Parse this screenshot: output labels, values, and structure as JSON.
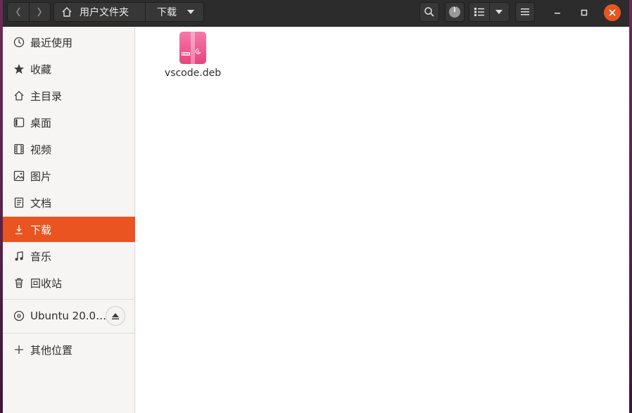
{
  "header": {
    "path": [
      {
        "label": "用户文件夹",
        "icon": "home-icon"
      },
      {
        "label": "下载",
        "icon": "chevron-down-icon"
      }
    ]
  },
  "sidebar": {
    "items": [
      {
        "label": "最近使用",
        "icon": "clock-icon"
      },
      {
        "label": "收藏",
        "icon": "star-icon"
      },
      {
        "label": "主目录",
        "icon": "home-icon"
      },
      {
        "label": "桌面",
        "icon": "desktop-icon"
      },
      {
        "label": "视频",
        "icon": "film-icon"
      },
      {
        "label": "图片",
        "icon": "image-icon"
      },
      {
        "label": "文档",
        "icon": "document-icon"
      },
      {
        "label": "下载",
        "icon": "download-icon",
        "active": true
      },
      {
        "label": "音乐",
        "icon": "music-icon"
      },
      {
        "label": "回收站",
        "icon": "trash-icon"
      }
    ],
    "devices": [
      {
        "label": "Ubuntu 20.0…",
        "icon": "disc-icon"
      }
    ],
    "other": {
      "label": "其他位置",
      "icon": "plus-icon"
    }
  },
  "files": [
    {
      "name": "vscode.deb",
      "icon": "deb-package-icon"
    }
  ],
  "colors": {
    "accent": "#e95420",
    "headerbar": "#2c2c2c",
    "file_icon": "#f0609a"
  }
}
